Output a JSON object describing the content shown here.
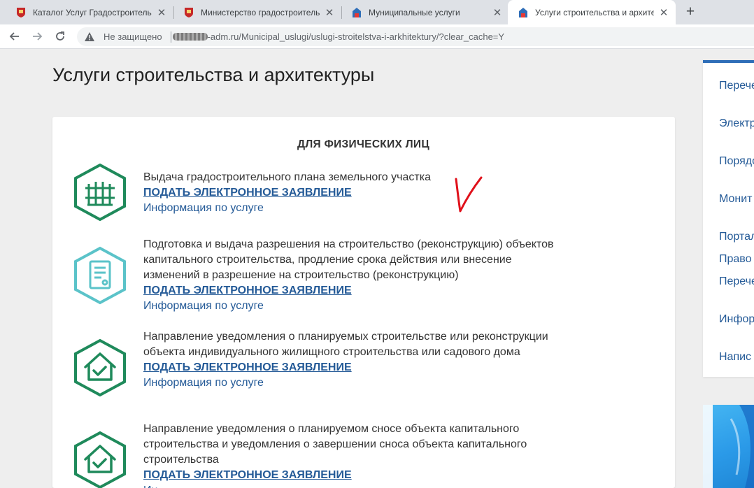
{
  "browser": {
    "tabs": [
      {
        "title": "Каталог Услуг Градостроительн",
        "active": false,
        "favicon": "coat-of-arms-icon"
      },
      {
        "title": "Министерство градостроитель",
        "active": false,
        "favicon": "coat-of-arms-icon"
      },
      {
        "title": "Муниципальные услуги",
        "active": false,
        "favicon": "site-logo-icon"
      },
      {
        "title": "Услуги строительства и архите",
        "active": true,
        "favicon": "site-logo-icon"
      }
    ],
    "new_tab_label": "+",
    "security_label": "Не защищено",
    "url": "-adm.ru/Municipal_uslugi/uslugi-stroitelstva-i-arkhitektury/?clear_cache=Y"
  },
  "page": {
    "title": "Услуги строительства и архитектуры",
    "section_heading": "ДЛЯ ФИЗИЧЕСКИХ ЛИЦ",
    "services": [
      {
        "name": "Выдача градостроительного плана земельного участка",
        "apply_label": "ПОДАТЬ ЭЛЕКТРОННОЕ ЗАЯВЛЕНИЕ",
        "info_label": "Информация по услуге",
        "icon": "fence-icon"
      },
      {
        "name": "Подготовка и выдача разрешения на строительство (реконструкцию) объектов капитального строительства, продление срока действия или внесение изменений в разрешение на строительство (реконструкцию)",
        "apply_label": "ПОДАТЬ ЭЛЕКТРОННОЕ ЗАЯВЛЕНИЕ",
        "info_label": "Информация по услуге",
        "icon": "document-icon"
      },
      {
        "name": "Направление уведомления о планируемых строительстве или реконструкции объекта индивидуального жилищного строительства или садового дома",
        "apply_label": "ПОДАТЬ ЭЛЕКТРОННОЕ ЗАЯВЛЕНИЕ",
        "info_label": "Информация по услуге",
        "icon": "house-check-icon"
      },
      {
        "name": "Направление уведомления о планируемом сносе объекта капитального строительства и уведомления о завершении сноса объекта капитального строительства",
        "apply_label": "ПОДАТЬ ЭЛЕКТРОННОЕ ЗАЯВЛЕНИЕ",
        "info_label": "Ин",
        "icon": "house-check-icon"
      }
    ]
  },
  "sidebar": {
    "items": [
      {
        "label": "Перечень услуг К"
      },
      {
        "label": "Электронные Нижег"
      },
      {
        "label": "Порядок муниц"
      },
      {
        "label": "Монит предос"
      },
      {
        "label": "Портал"
      },
      {
        "label": "Право"
      },
      {
        "label": "Перечень услуг"
      },
      {
        "label": "Инфор сотруд"
      },
      {
        "label": "Напис"
      }
    ]
  },
  "colors": {
    "accent_green": "#1f8a5b",
    "accent_teal": "#5bc3c9",
    "link_blue": "#245a97",
    "annotation_red": "#e0101a"
  }
}
